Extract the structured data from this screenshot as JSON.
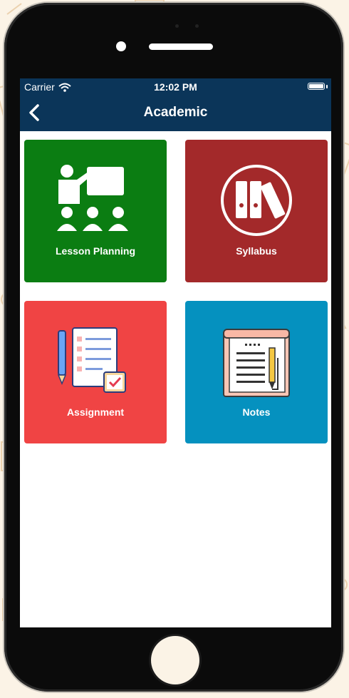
{
  "status_bar": {
    "carrier": "Carrier",
    "time": "12:02 PM",
    "wifi_icon": "wifi-icon",
    "battery_icon": "battery-icon"
  },
  "nav": {
    "title": "Academic",
    "back_icon": "chevron-left-icon"
  },
  "tiles": [
    {
      "label": "Lesson Planning",
      "color": "#0b7d12",
      "icon": "teacher-classroom-icon"
    },
    {
      "label": "Syllabus",
      "color": "#a3292a",
      "icon": "binders-icon"
    },
    {
      "label": "Assignment",
      "color": "#f04444",
      "icon": "assignment-checklist-icon"
    },
    {
      "label": "Notes",
      "color": "#0591bf",
      "icon": "notebook-pencil-icon"
    }
  ],
  "colors": {
    "header": "#0b3559",
    "background": "#fbf3e6",
    "phone_body": "#0b0b0b"
  }
}
